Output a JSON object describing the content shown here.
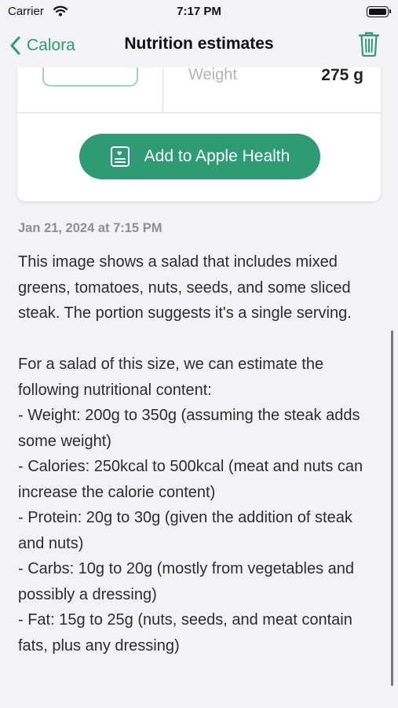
{
  "status_bar": {
    "carrier": "Carrier",
    "time": "7:17 PM"
  },
  "nav": {
    "back_label": "Calora",
    "title": "Nutrition estimates",
    "accent_color": "#2e9b75"
  },
  "card": {
    "weight_label": "Weight",
    "weight_value": "275 g",
    "add_health_label": "Add to Apple Health"
  },
  "entry": {
    "timestamp": "Jan 21, 2024 at 7:15 PM",
    "intro": "This image shows a salad that includes mixed greens, tomatoes, nuts, seeds, and some sliced steak. The portion suggests it's a single serving.",
    "lead": "For a salad of this size, we can estimate the following nutritional content:",
    "items": [
      "- Weight: 200g to 350g (assuming the steak adds some weight)",
      "- Calories: 250kcal to 500kcal (meat and nuts can increase the calorie content)",
      "- Protein: 20g to 30g (given the addition of steak and nuts)",
      "- Carbs: 10g to 20g (mostly from vegetables and possibly a dressing)",
      "- Fat: 15g to 25g (nuts, seeds, and meat contain fats, plus any dressing)"
    ]
  }
}
